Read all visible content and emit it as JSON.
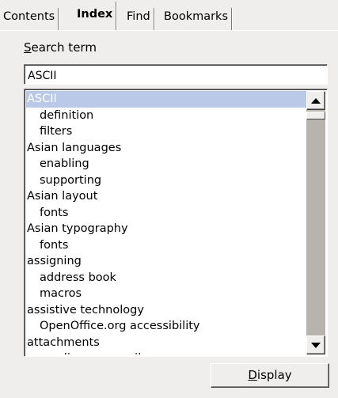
{
  "tabs": [
    {
      "label": "Contents",
      "active": false
    },
    {
      "label": "Index",
      "active": true
    },
    {
      "label": "Find",
      "active": false
    },
    {
      "label": "Bookmarks",
      "active": false
    }
  ],
  "search": {
    "label_mnemonic": "S",
    "label_rest": "earch term",
    "value": "ASCII"
  },
  "index_items": [
    {
      "text": "ASCII",
      "level": 0,
      "selected": true
    },
    {
      "text": "definition",
      "level": 1
    },
    {
      "text": "filters",
      "level": 1
    },
    {
      "text": "Asian languages",
      "level": 0
    },
    {
      "text": "enabling",
      "level": 1
    },
    {
      "text": "supporting",
      "level": 1
    },
    {
      "text": "Asian layout",
      "level": 0
    },
    {
      "text": "fonts",
      "level": 1
    },
    {
      "text": "Asian typography",
      "level": 0
    },
    {
      "text": "fonts",
      "level": 1
    },
    {
      "text": "assigning",
      "level": 0
    },
    {
      "text": "address book",
      "level": 1
    },
    {
      "text": "macros",
      "level": 1
    },
    {
      "text": "assistive technology",
      "level": 0
    },
    {
      "text": "OpenOffice.org accessibility",
      "level": 1
    },
    {
      "text": "attachments",
      "level": 0
    },
    {
      "text": "sending as e-mail",
      "level": 1
    }
  ],
  "display_button": {
    "mnemonic": "D",
    "rest": "isplay"
  },
  "colors": {
    "background": "#efeeec",
    "selection": "#b9c9e7",
    "scroll_track": "#b7b4ae"
  }
}
